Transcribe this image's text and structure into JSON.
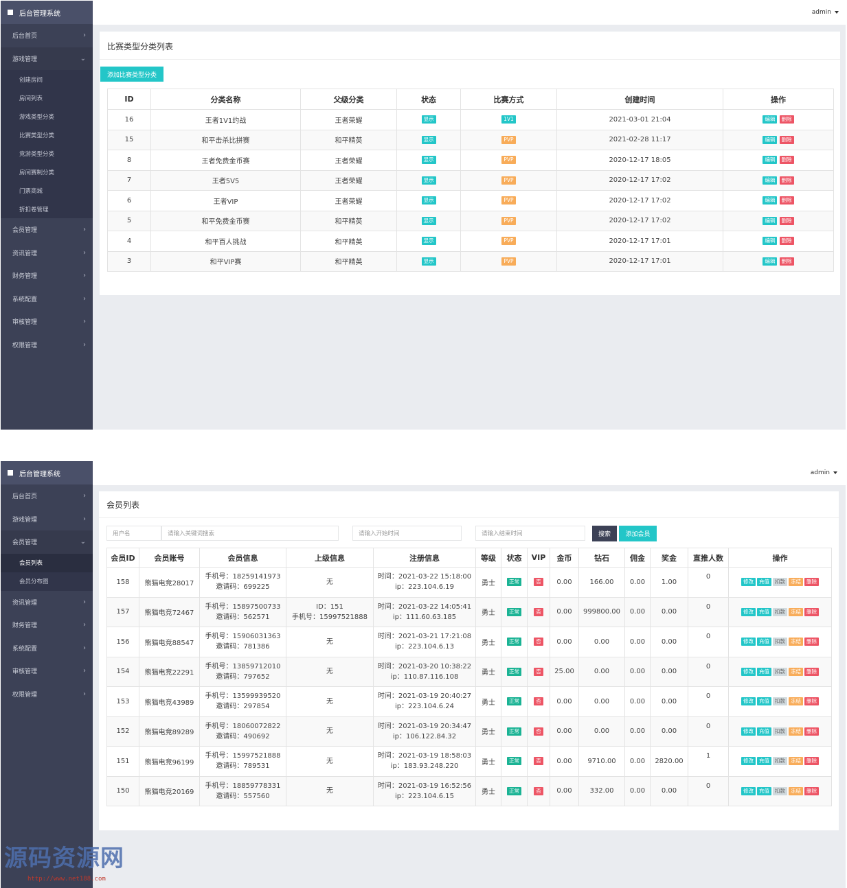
{
  "app": {
    "brand": "后台管理系统",
    "user": "admin"
  },
  "shot1": {
    "menu": [
      {
        "label": "后台首页"
      },
      {
        "label": "游戏管理",
        "open": true,
        "sub": [
          "创建房间",
          "房间列表",
          "游戏类型分类",
          "比赛类型分类",
          "竞游类型分类",
          "房间赛制分类",
          "门票商城",
          "折扣卷管理"
        ]
      },
      {
        "label": "会员管理"
      },
      {
        "label": "资讯管理"
      },
      {
        "label": "财务管理"
      },
      {
        "label": "系统配置"
      },
      {
        "label": "审核管理"
      },
      {
        "label": "权限管理"
      }
    ],
    "title": "比赛类型分类列表",
    "add_button": "添加比赛类型分类",
    "columns": [
      "ID",
      "分类名称",
      "父级分类",
      "状态",
      "比赛方式",
      "创建时间",
      "操作"
    ],
    "edit_label": "编辑",
    "delete_label": "删除",
    "rows": [
      {
        "id": "16",
        "name": "王者1V1约战",
        "parent": "王者荣耀",
        "status": "显示",
        "mode": "1V1",
        "created": "2021-03-01 21:04"
      },
      {
        "id": "15",
        "name": "和平击杀比拼赛",
        "parent": "和平精英",
        "status": "显示",
        "mode": "PVP",
        "created": "2021-02-28 11:17"
      },
      {
        "id": "8",
        "name": "王者免费金币赛",
        "parent": "王者荣耀",
        "status": "显示",
        "mode": "PVP",
        "created": "2020-12-17 18:05"
      },
      {
        "id": "7",
        "name": "王者5V5",
        "parent": "王者荣耀",
        "status": "显示",
        "mode": "PVP",
        "created": "2020-12-17 17:02"
      },
      {
        "id": "6",
        "name": "王者VIP",
        "parent": "王者荣耀",
        "status": "显示",
        "mode": "PVP",
        "created": "2020-12-17 17:02"
      },
      {
        "id": "5",
        "name": "和平免费金币赛",
        "parent": "和平精英",
        "status": "显示",
        "mode": "PVP",
        "created": "2020-12-17 17:02"
      },
      {
        "id": "4",
        "name": "和平百人挑战",
        "parent": "和平精英",
        "status": "显示",
        "mode": "PVP",
        "created": "2020-12-17 17:01"
      },
      {
        "id": "3",
        "name": "和平VIP赛",
        "parent": "和平精英",
        "status": "显示",
        "mode": "PVP",
        "created": "2020-12-17 17:01"
      }
    ]
  },
  "shot2": {
    "menu": [
      {
        "label": "后台首页"
      },
      {
        "label": "游戏管理"
      },
      {
        "label": "会员管理",
        "open": true,
        "sub": [
          "会员列表",
          "会员分布图"
        ]
      },
      {
        "label": "资讯管理"
      },
      {
        "label": "财务管理"
      },
      {
        "label": "系统配置"
      },
      {
        "label": "审核管理"
      },
      {
        "label": "权限管理"
      }
    ],
    "title": "会员列表",
    "filter": {
      "field_label": "用户名",
      "keyword_placeholder": "请输入关键词搜索",
      "start_placeholder": "请输入开始时间",
      "end_placeholder": "请输入结束时间",
      "search_button": "搜索",
      "add_button": "添加会员"
    },
    "columns": [
      "会员ID",
      "会员账号",
      "会员信息",
      "上级信息",
      "注册信息",
      "等级",
      "状态",
      "VIP",
      "金币",
      "钻石",
      "佣金",
      "奖金",
      "直推人数",
      "操作"
    ],
    "actions": [
      "修改",
      "充值",
      "扣款",
      "冻结",
      "删除"
    ],
    "rows": [
      {
        "id": "158",
        "account": "熊猫电竞28017",
        "phone": "手机号：18259141973",
        "invite": "邀请码：699225",
        "parent1": "无",
        "parent2": "",
        "time": "时间：2021-03-22 15:18:00",
        "ip": "ip：223.104.6.19",
        "level": "勇士",
        "status": "正常",
        "vip": "否",
        "gold": "0.00",
        "diamond": "166.00",
        "commission": "0.00",
        "bonus": "1.00",
        "direct": "0"
      },
      {
        "id": "157",
        "account": "熊猫电竞72467",
        "phone": "手机号：15897500733",
        "invite": "邀请码：562571",
        "parent1": "ID：151",
        "parent2": "手机号：15997521888",
        "time": "时间：2021-03-22 14:05:41",
        "ip": "ip：111.60.63.185",
        "level": "勇士",
        "status": "正常",
        "vip": "否",
        "gold": "0.00",
        "diamond": "999800.00",
        "commission": "0.00",
        "bonus": "0.00",
        "direct": "0"
      },
      {
        "id": "156",
        "account": "熊猫电竞88547",
        "phone": "手机号：15906031363",
        "invite": "邀请码：781386",
        "parent1": "无",
        "parent2": "",
        "time": "时间：2021-03-21 17:21:08",
        "ip": "ip：223.104.6.13",
        "level": "勇士",
        "status": "正常",
        "vip": "否",
        "gold": "0.00",
        "diamond": "0.00",
        "commission": "0.00",
        "bonus": "0.00",
        "direct": "0"
      },
      {
        "id": "154",
        "account": "熊猫电竞22291",
        "phone": "手机号：13859712010",
        "invite": "邀请码：797652",
        "parent1": "无",
        "parent2": "",
        "time": "时间：2021-03-20 10:38:22",
        "ip": "ip：110.87.116.108",
        "level": "勇士",
        "status": "正常",
        "vip": "否",
        "gold": "25.00",
        "diamond": "0.00",
        "commission": "0.00",
        "bonus": "0.00",
        "direct": "0"
      },
      {
        "id": "153",
        "account": "熊猫电竞43989",
        "phone": "手机号：13599939520",
        "invite": "邀请码：297854",
        "parent1": "无",
        "parent2": "",
        "time": "时间：2021-03-19 20:40:27",
        "ip": "ip：223.104.6.24",
        "level": "勇士",
        "status": "正常",
        "vip": "否",
        "gold": "0.00",
        "diamond": "0.00",
        "commission": "0.00",
        "bonus": "0.00",
        "direct": "0"
      },
      {
        "id": "152",
        "account": "熊猫电竞89289",
        "phone": "手机号：18060072822",
        "invite": "邀请码：490692",
        "parent1": "无",
        "parent2": "",
        "time": "时间：2021-03-19 20:34:47",
        "ip": "ip：106.122.84.32",
        "level": "勇士",
        "status": "正常",
        "vip": "否",
        "gold": "0.00",
        "diamond": "0.00",
        "commission": "0.00",
        "bonus": "0.00",
        "direct": "0"
      },
      {
        "id": "151",
        "account": "熊猫电竞96199",
        "phone": "手机号：15997521888",
        "invite": "邀请码：789531",
        "parent1": "无",
        "parent2": "",
        "time": "时间：2021-03-19 18:58:03",
        "ip": "ip：183.93.248.220",
        "level": "勇士",
        "status": "正常",
        "vip": "否",
        "gold": "0.00",
        "diamond": "9710.00",
        "commission": "0.00",
        "bonus": "2820.00",
        "direct": "1"
      },
      {
        "id": "150",
        "account": "熊猫电竞20169",
        "phone": "手机号：18859778331",
        "invite": "邀请码：557560",
        "parent1": "无",
        "parent2": "",
        "time": "时间：2021-03-19 16:52:56",
        "ip": "ip：223.104.6.15",
        "level": "勇士",
        "status": "正常",
        "vip": "否",
        "gold": "0.00",
        "diamond": "332.00",
        "commission": "0.00",
        "bonus": "0.00",
        "direct": "0"
      }
    ]
  },
  "watermark": {
    "text": "源码资源网",
    "url": "http://www.net188.com"
  },
  "colors": {
    "sidebar": "#3c4156",
    "cyan": "#23c6c8",
    "orange": "#f8ac59",
    "red": "#ed5565",
    "green": "#1ab394",
    "gray": "#d1dade"
  }
}
